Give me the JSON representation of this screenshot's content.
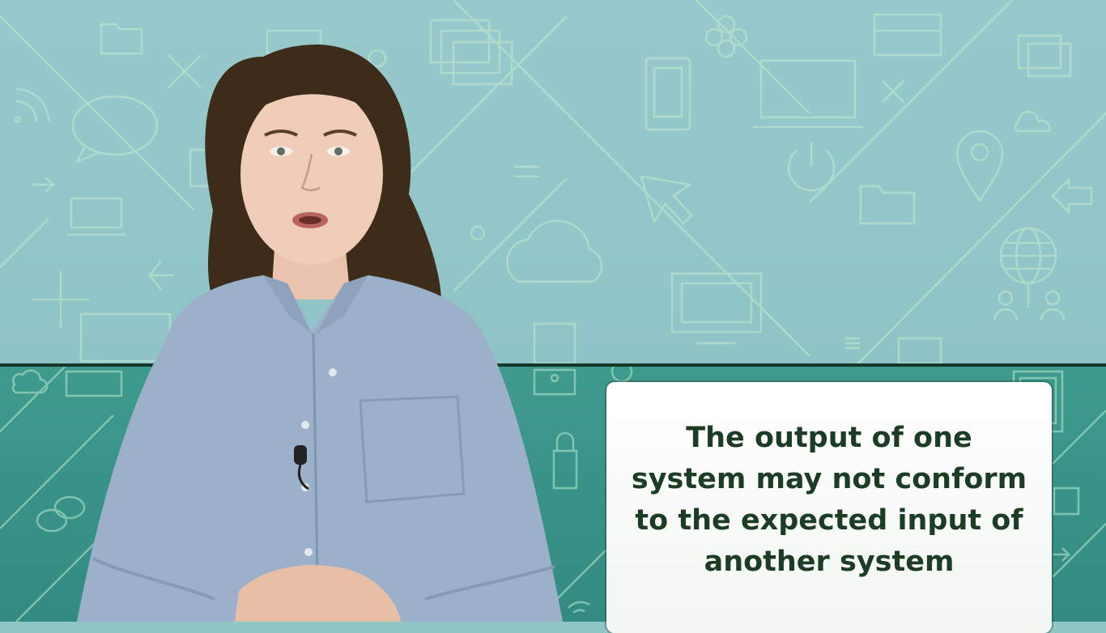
{
  "caption": {
    "text": "The output of one system may not conform to the expected input of another system"
  },
  "scene": {
    "background_top_color": "#93c7c9",
    "background_bottom_color": "#3a9388",
    "divider_color": "#14382a",
    "icon_line_color": "#b8e0cc",
    "caption_text_color": "#1c3c24",
    "shirt_color": "#9db0c9",
    "hair_color": "#3d2a19"
  },
  "icons": [
    "folder-icon",
    "window-icon",
    "speech-bubble-icon",
    "tablet-icon",
    "monitor-icon",
    "cloud-icon",
    "power-icon",
    "location-pin-icon",
    "globe-icon",
    "users-icon",
    "cursor-arrow-icon",
    "lock-icon",
    "wifi-icon",
    "close-icon",
    "arrow-left-icon",
    "arrow-right-icon"
  ]
}
